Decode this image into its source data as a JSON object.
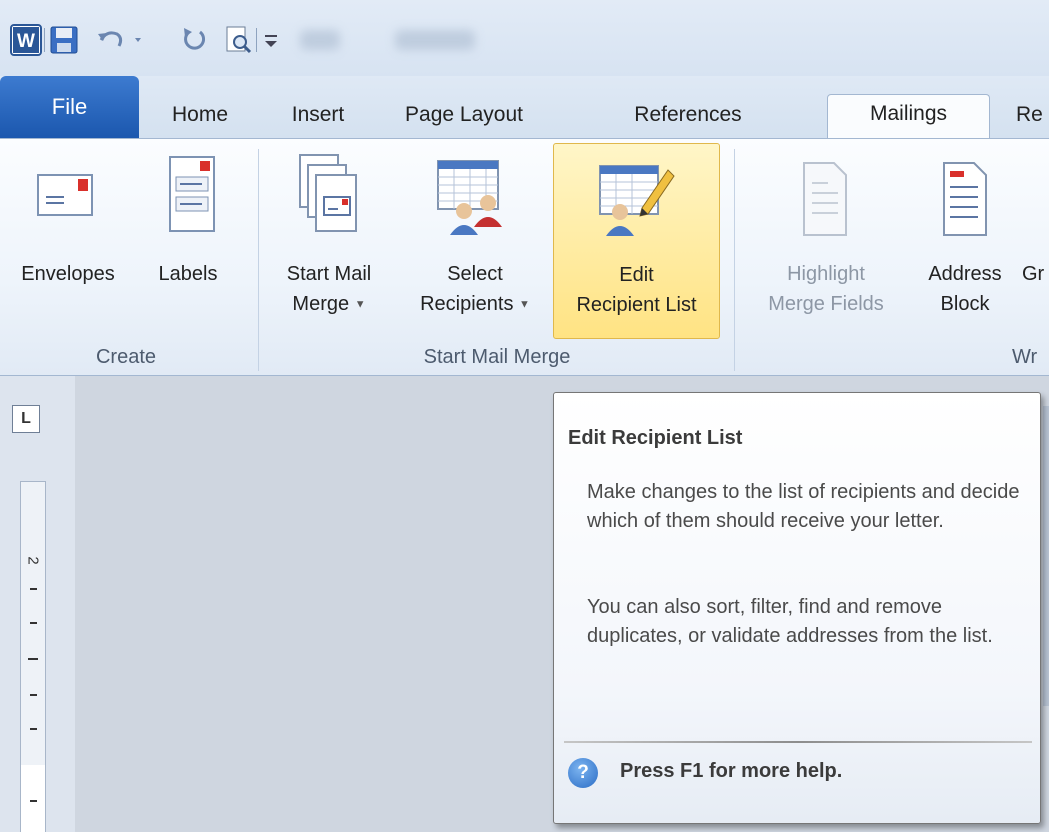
{
  "quick_access": {
    "icons": [
      "word-app-icon",
      "save-icon",
      "undo-icon",
      "redo-icon",
      "print-preview-icon",
      "customize-toolbar-icon"
    ]
  },
  "tabs": [
    {
      "label": "File"
    },
    {
      "label": "Home"
    },
    {
      "label": "Insert"
    },
    {
      "label": "Page Layout"
    },
    {
      "label": "References"
    },
    {
      "label": "Mailings"
    },
    {
      "label": "Re"
    }
  ],
  "ribbon": {
    "create": {
      "envelopes": "Envelopes",
      "labels": "Labels",
      "group_label": "Create"
    },
    "start_mail_merge": {
      "start_mail_merge_line1": "Start Mail",
      "start_mail_merge_line2": "Merge",
      "select_recipients_line1": "Select",
      "select_recipients_line2": "Recipients",
      "edit_recipient_line1": "Edit",
      "edit_recipient_line2": "Recipient List",
      "group_label": "Start Mail Merge"
    },
    "write_insert": {
      "highlight_line1": "Highlight",
      "highlight_line2": "Merge Fields",
      "address_line1": "Address",
      "address_line2": "Block",
      "greeting_partial": "Gr",
      "group_label_partial": "Wr"
    }
  },
  "ruler": {
    "tab_selector": "L",
    "number": "2"
  },
  "tooltip": {
    "title": "Edit Recipient List",
    "paragraph1": "Make changes to the list of recipients and decide which of them should receive your letter.",
    "paragraph2": "You can also sort, filter, find and remove duplicates, or validate addresses from the list.",
    "help_icon_glyph": "?",
    "help_text": "Press F1 for more help."
  },
  "colors": {
    "file_tab": "#2a63b8",
    "highlight": "#ffe383",
    "tooltip_border": "#767676"
  }
}
